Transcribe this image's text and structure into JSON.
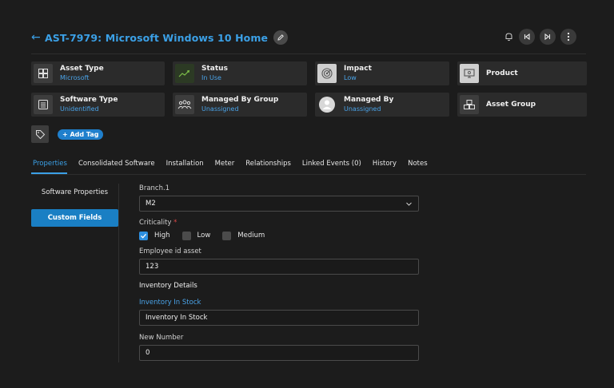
{
  "header": {
    "title": "AST-7979: Microsoft Windows 10 Home"
  },
  "cards": [
    {
      "title": "Asset Type",
      "sub": "Microsoft",
      "icon": "windows-icon"
    },
    {
      "title": "Status",
      "sub": "In Use",
      "icon": "trend-icon"
    },
    {
      "title": "Impact",
      "sub": "Low",
      "icon": "target-icon"
    },
    {
      "title": "Product",
      "sub": "",
      "icon": "monitor-icon"
    },
    {
      "title": "Software Type",
      "sub": "Unidentified",
      "icon": "list-icon"
    },
    {
      "title": "Managed By Group",
      "sub": "Unassigned",
      "icon": "group-icon"
    },
    {
      "title": "Managed By",
      "sub": "Unassigned",
      "icon": "avatar-icon"
    },
    {
      "title": "Asset Group",
      "sub": "",
      "icon": "boxes-icon"
    }
  ],
  "tags": {
    "add_label": "+ Add Tag"
  },
  "tabs": [
    {
      "label": "Properties",
      "active": true
    },
    {
      "label": "Consolidated Software"
    },
    {
      "label": "Installation"
    },
    {
      "label": "Meter"
    },
    {
      "label": "Relationships"
    },
    {
      "label": "Linked Events (0)"
    },
    {
      "label": "History"
    },
    {
      "label": "Notes"
    }
  ],
  "side_nav": [
    {
      "label": "Software Properties"
    },
    {
      "label": "Custom Fields",
      "active": true
    }
  ],
  "form": {
    "branch": {
      "label": "Branch.1",
      "value": "M2"
    },
    "criticality": {
      "label": "Criticality",
      "required_mark": "*",
      "options": [
        {
          "label": "High",
          "checked": true
        },
        {
          "label": "Low",
          "checked": false
        },
        {
          "label": "Medium",
          "checked": false
        }
      ]
    },
    "employee_id": {
      "label": "Employee id asset",
      "value": "123"
    },
    "inventory_section": "Inventory Details",
    "inventory_in_stock": {
      "label": "Inventory In Stock",
      "value": "Inventory In Stock"
    },
    "new_number": {
      "label": "New Number",
      "value": "0"
    }
  },
  "colors": {
    "accent": "#3ba0e6",
    "background": "#1c1c1c",
    "card": "#2b2b2b"
  }
}
